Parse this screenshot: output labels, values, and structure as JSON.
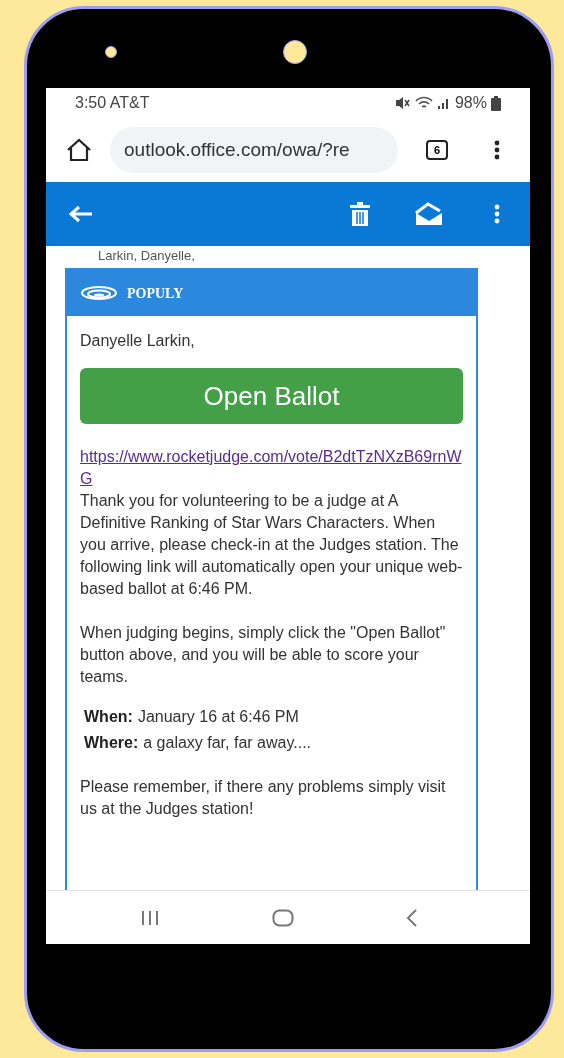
{
  "status_bar": {
    "time_carrier": "3:50 AT&T",
    "battery": "98%"
  },
  "browser": {
    "url": "outlook.office.com/owa/?re",
    "tab_count": "6"
  },
  "email": {
    "sender_line": "Larkin, Danyelle,",
    "card": {
      "brand": "POPULY",
      "greeting": "Danyelle Larkin,",
      "button": "Open Ballot",
      "link": "https://www.rocketjudge.com/vote/B2dtTzNXzB69rnWG",
      "paragraphs": [
        "Thank you for volunteering to be a judge at A Definitive Ranking of Star Wars Characters. When you arrive, please check-in at the Judges station. The following link will automatically open your unique web-based ballot at 6:46 PM.",
        "When judging begins, simply click the \"Open Ballot\" button above, and you will be able to score your teams."
      ],
      "details": [
        {
          "label": "When:",
          "value": "January 16 at 6:46 PM"
        },
        {
          "label": "Where:",
          "value": "a galaxy far, far away...."
        }
      ],
      "closing": "Please remember, if there any problems simply visit us at the Judges station!"
    }
  }
}
